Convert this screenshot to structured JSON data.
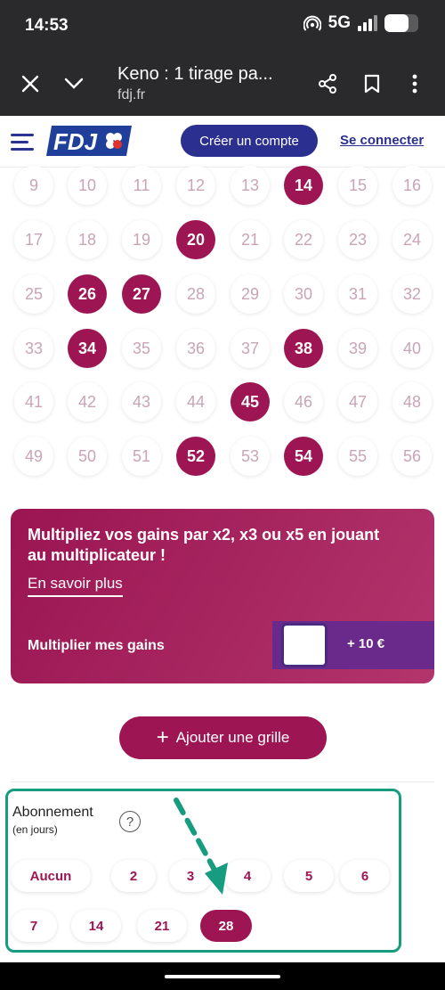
{
  "status_bar": {
    "time": "14:53",
    "network": "5G",
    "battery_level": 0.7
  },
  "browser": {
    "title": "Keno : 1 tirage pa...",
    "url": "fdj.fr"
  },
  "header": {
    "logo_text": "FDJ",
    "create_account": "Créer un compte",
    "login": "Se connecter"
  },
  "grid": {
    "numbers": [
      9,
      10,
      11,
      12,
      13,
      14,
      15,
      16,
      17,
      18,
      19,
      20,
      21,
      22,
      23,
      24,
      25,
      26,
      27,
      28,
      29,
      30,
      31,
      32,
      33,
      34,
      35,
      36,
      37,
      38,
      39,
      40,
      41,
      42,
      43,
      44,
      45,
      46,
      47,
      48,
      49,
      50,
      51,
      52,
      53,
      54,
      55,
      56
    ],
    "selected": [
      14,
      20,
      26,
      27,
      34,
      38,
      45,
      52,
      54
    ]
  },
  "promo": {
    "headline": "Multipliez vos gains par x2, x3 ou x5 en jouant au multiplicateur !",
    "link": "En savoir plus",
    "option_label": "Multiplier mes gains",
    "option_price": "+ 10 €"
  },
  "add_grid": {
    "plus": "+",
    "label": "Ajouter une grille"
  },
  "subscription": {
    "title": "Abonnement",
    "subtitle": "(en jours)",
    "help": "?",
    "options": [
      "Aucun",
      "2",
      "3",
      "4",
      "5",
      "6",
      "7",
      "14",
      "21",
      "28"
    ],
    "selected": "28"
  },
  "colors": {
    "accent": "#9d1552",
    "brand": "#2b2f8f",
    "highlight_box": "#179c7f"
  }
}
